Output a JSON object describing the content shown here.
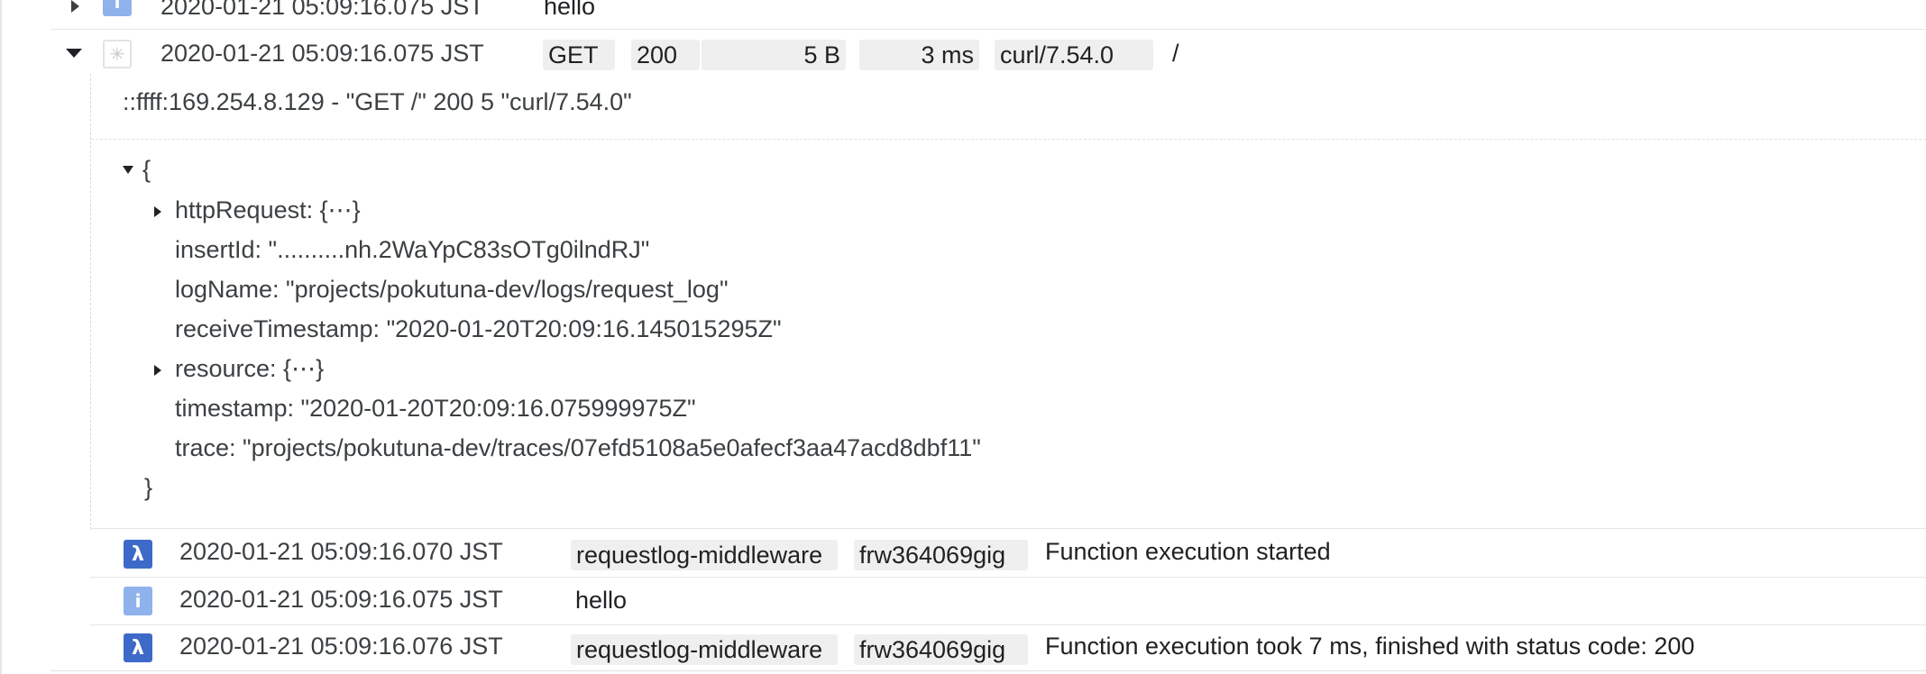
{
  "top_row": {
    "timestamp": "2020-01-21 05:09:16.075 JST",
    "message": "hello",
    "severity_icon": "info-icon",
    "severity_glyph": "i"
  },
  "request_row": {
    "timestamp": "2020-01-21 05:09:16.075 JST",
    "severity_icon": "default-severity-icon",
    "severity_glyph": "✳",
    "method": "GET",
    "status": "200",
    "size": "5 B",
    "latency": "3 ms",
    "user_agent": "curl/7.54.0",
    "path": "/"
  },
  "detail": {
    "summary": "::ffff:169.254.8.129 - \"GET /\" 200 5 \"curl/7.54.0\"",
    "open_brace": "{",
    "close_brace": "}",
    "fields": [
      {
        "text": "httpRequest: {⋯}",
        "expandable": true
      },
      {
        "text": "insertId: \"..........nh.2WaYpC83sOTg0ilndRJ\"",
        "expandable": false
      },
      {
        "text": "logName: \"projects/pokutuna-dev/logs/request_log\"",
        "expandable": false
      },
      {
        "text": "receiveTimestamp: \"2020-01-20T20:09:16.145015295Z\"",
        "expandable": false
      },
      {
        "text": "resource: {⋯}",
        "expandable": true
      },
      {
        "text": "timestamp: \"2020-01-20T20:09:16.075999975Z\"",
        "expandable": false
      },
      {
        "text": "trace: \"projects/pokutuna-dev/traces/07efd5108a5e0afecf3aa47acd8dbf11\"",
        "expandable": false
      }
    ]
  },
  "entries": [
    {
      "timestamp": "2020-01-21 05:09:16.070 JST",
      "severity_icon": "lambda-icon",
      "glyph": "λ",
      "function": "requestlog-middleware",
      "execution_id": "frw364069gig",
      "message": "Function execution started"
    },
    {
      "timestamp": "2020-01-21 05:09:16.075 JST",
      "severity_icon": "info-icon",
      "glyph": "i",
      "message": "hello"
    },
    {
      "timestamp": "2020-01-21 05:09:16.076 JST",
      "severity_icon": "lambda-icon",
      "glyph": "λ",
      "function": "requestlog-middleware",
      "execution_id": "frw364069gig",
      "message": "Function execution took 7 ms, finished with status code: 200"
    }
  ],
  "colors": {
    "info": "#8fb1ec",
    "lambda": "#3d6ac8",
    "chip_bg": "#efefef"
  }
}
